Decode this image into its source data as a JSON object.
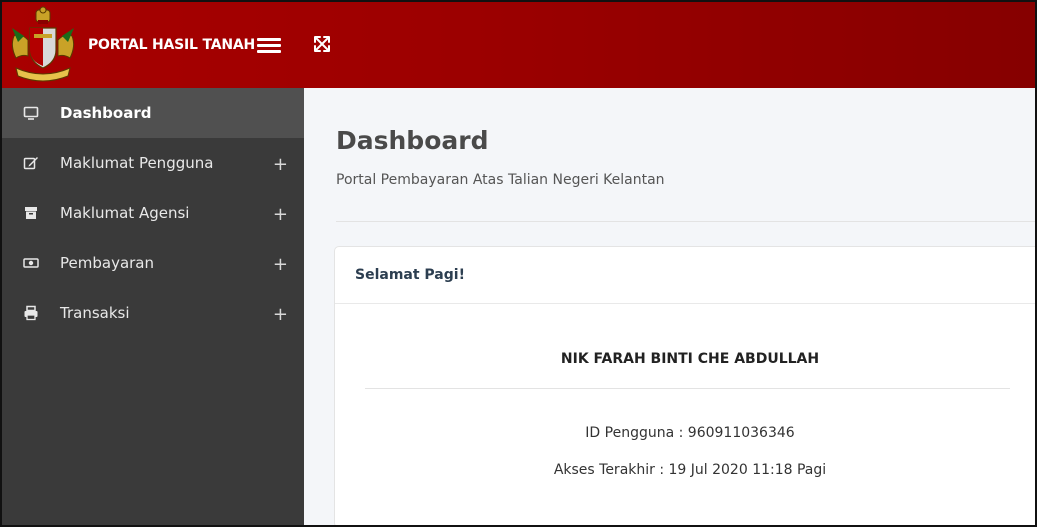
{
  "header": {
    "brand_title": "PORTAL HASIL TANAH",
    "colors": {
      "bar": "#9c0000",
      "sidebar": "#3a3a3a",
      "sidebar_active": "#505050"
    }
  },
  "sidebar": {
    "items": [
      {
        "label": "Dashboard",
        "icon": "monitor-icon",
        "expandable": false,
        "active": true
      },
      {
        "label": "Maklumat Pengguna",
        "icon": "edit-icon",
        "expandable": true,
        "active": false
      },
      {
        "label": "Maklumat Agensi",
        "icon": "archive-icon",
        "expandable": true,
        "active": false
      },
      {
        "label": "Pembayaran",
        "icon": "money-icon",
        "expandable": true,
        "active": false
      },
      {
        "label": "Transaksi",
        "icon": "print-icon",
        "expandable": true,
        "active": false
      }
    ],
    "expand_symbol": "+"
  },
  "main": {
    "title": "Dashboard",
    "subtitle": "Portal Pembayaran Atas Talian Negeri Kelantan",
    "card": {
      "header": "Selamat Pagi!",
      "user_name": "NIK FARAH BINTI CHE ABDULLAH",
      "user_id": "ID Pengguna : 960911036346",
      "last_access": "Akses Terakhir : 19 Jul 2020 11:18 Pagi"
    }
  }
}
